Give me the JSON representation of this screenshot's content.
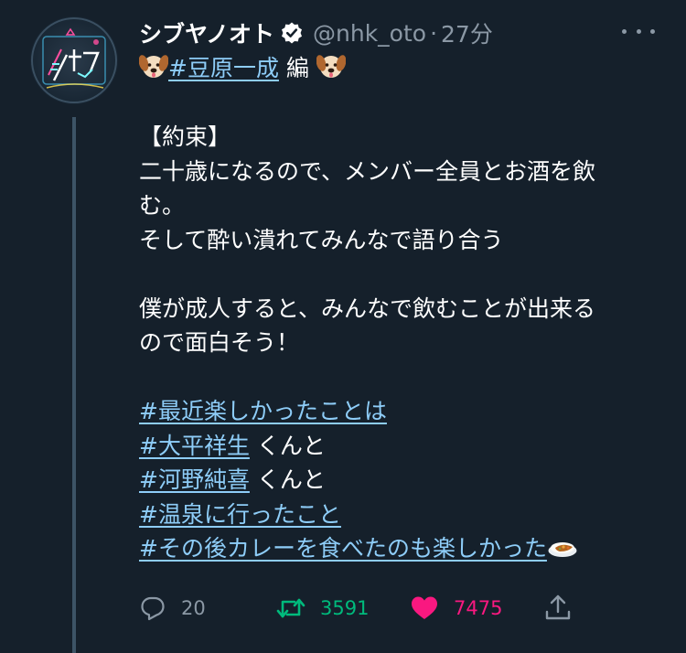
{
  "tweet": {
    "display_name": "シブヤノオト",
    "handle": "@nhk_oto",
    "separator": "·",
    "time": "27分",
    "title_line": {
      "tag": "#豆原一成",
      "suffix": " 編"
    },
    "body": {
      "heading": "【約束】",
      "line1": "二十歳になるので、メンバー全員とお酒を飲",
      "line2": "む。",
      "line3": "そして酔い潰れてみんなで語り合う",
      "line4": "僕が成人すると、みんなで飲むことが出来る",
      "line5": "ので面白そう！"
    },
    "hashtags": {
      "h1": "#最近楽しかったことは",
      "h2": "#大平祥生",
      "h2_suffix": " くんと",
      "h3": "#河野純喜",
      "h3_suffix": " くんと",
      "h4": "#温泉に行ったこと",
      "h5": "#その後カレーを食べたのも楽しかった"
    }
  },
  "actions": {
    "reply_count": "20",
    "retweet_count": "3591",
    "like_count": "7475"
  },
  "icons": {
    "avatar": "shibuya-no-oto-neon-logo",
    "verified": "verified-badge-icon",
    "more": "more-options-icon",
    "dog": "dog-face-emoji",
    "curry": "curry-rice-emoji",
    "reply": "reply-icon",
    "retweet": "retweet-icon",
    "like": "heart-icon",
    "share": "share-icon"
  },
  "colors": {
    "background": "#15202b",
    "hashtag": "#8ecdf8",
    "muted": "#8b98a5",
    "retweet_active": "#00ba7c",
    "like_active": "#f91880"
  }
}
